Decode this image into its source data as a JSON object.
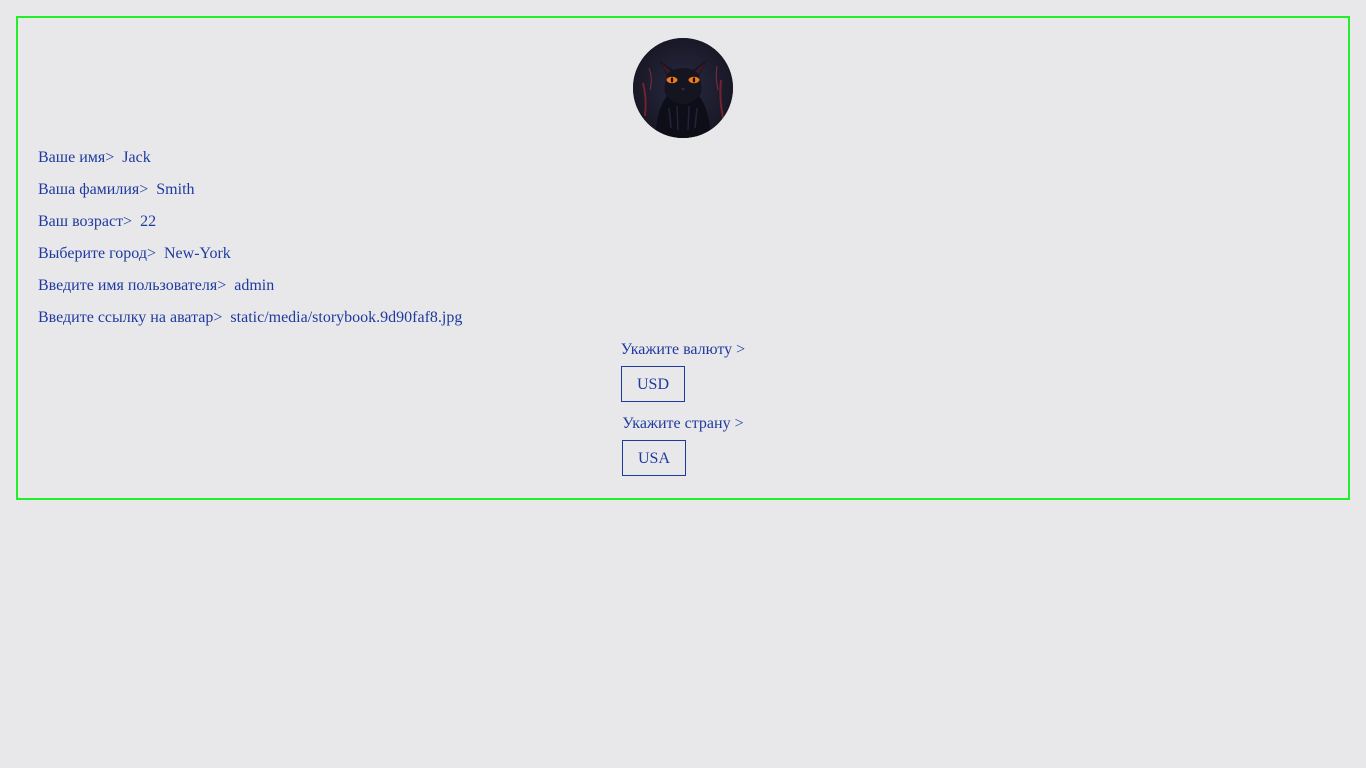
{
  "profile": {
    "avatar": {
      "description": "black cat illustration with orange eyes",
      "icon": "cat-avatar"
    },
    "fields": [
      {
        "label": "Ваше имя>",
        "value": "Jack"
      },
      {
        "label": "Ваша фамилия>",
        "value": "Smith"
      },
      {
        "label": "Ваш возраст>",
        "value": "22"
      },
      {
        "label": "Выберите город>",
        "value": "New-York"
      },
      {
        "label": "Введите имя пользователя>",
        "value": "admin"
      },
      {
        "label": "Введите ссылку на аватар>",
        "value": "static/media/storybook.9d90faf8.jpg"
      }
    ],
    "currency": {
      "label": "Укажите валюту >",
      "value": "USD"
    },
    "country": {
      "label": "Укажите страну >",
      "value": "USA"
    }
  },
  "colors": {
    "text": "#1f3a9e",
    "border": "#22ee2a",
    "background": "#e8e8eb"
  }
}
